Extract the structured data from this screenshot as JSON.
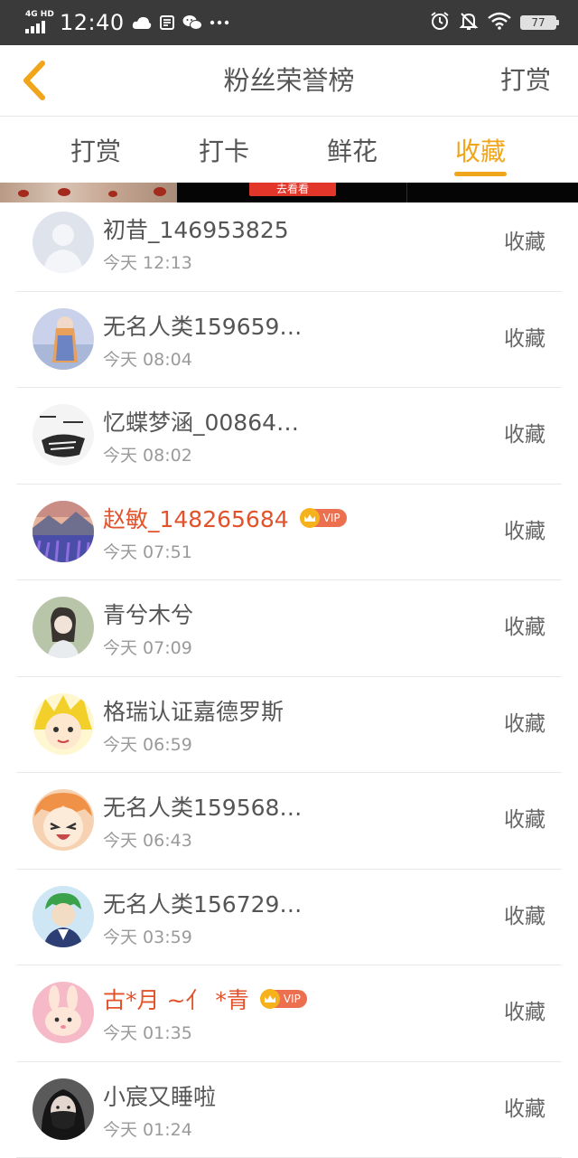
{
  "status_bar": {
    "network": "4G HD",
    "time": "12:40",
    "battery": "77",
    "icons": [
      "cloud-icon",
      "sim-icon",
      "wechat-icon",
      "more-dots-icon",
      "alarm-icon",
      "mute-bell-icon",
      "wifi-icon",
      "battery-icon"
    ]
  },
  "header": {
    "back_icon": "chevron-left-icon",
    "title": "粉丝荣誉榜",
    "right_action": "打赏"
  },
  "tabs": [
    {
      "label": "打赏",
      "active": false
    },
    {
      "label": "打卡",
      "active": false
    },
    {
      "label": "鲜花",
      "active": false
    },
    {
      "label": "收藏",
      "active": true
    }
  ],
  "ad_banner": {
    "button_label": "去看看"
  },
  "fans": [
    {
      "name": "初昔_146953825",
      "time": "今天 12:13",
      "vip": false,
      "action": "收藏",
      "avatar": "default-avatar"
    },
    {
      "name": "无名人类159659…",
      "time": "今天 08:04",
      "vip": false,
      "action": "收藏",
      "avatar": "anime-girl-avatar"
    },
    {
      "name": "忆蝶梦涵_00864…",
      "time": "今天 08:02",
      "vip": false,
      "action": "收藏",
      "avatar": "sketch-avatar"
    },
    {
      "name": "赵敏_148265684",
      "time": "今天 07:51",
      "vip": true,
      "action": "收藏",
      "avatar": "lavender-field-avatar"
    },
    {
      "name": "青兮木兮",
      "time": "今天 07:09",
      "vip": false,
      "action": "收藏",
      "avatar": "girl-photo-avatar"
    },
    {
      "name": "格瑞认证嘉德罗斯",
      "time": "今天 06:59",
      "vip": false,
      "action": "收藏",
      "avatar": "yellow-hair-anime-avatar"
    },
    {
      "name": "无名人类159568…",
      "time": "今天 06:43",
      "vip": false,
      "action": "收藏",
      "avatar": "crying-anime-avatar"
    },
    {
      "name": "无名人类156729…",
      "time": "今天 03:59",
      "vip": false,
      "action": "收藏",
      "avatar": "green-hair-anime-avatar"
    },
    {
      "name": "古*月 ~亻 *青",
      "time": "今天 01:35",
      "vip": true,
      "action": "收藏",
      "avatar": "pink-bunny-avatar"
    },
    {
      "name": "小宸又睡啦",
      "time": "今天 01:24",
      "vip": false,
      "action": "收藏",
      "avatar": "masked-person-avatar"
    }
  ],
  "vip_label": "VIP",
  "colors": {
    "accent": "#f0a51a",
    "vip_name": "#e2522b",
    "status_bar": "#3a3a3a",
    "text": "#555555",
    "subtext": "#9a9a9a"
  }
}
